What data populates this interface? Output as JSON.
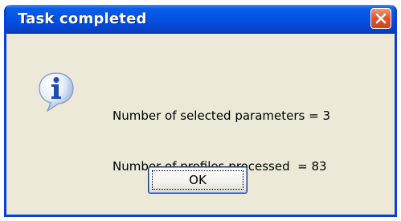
{
  "dialog": {
    "title": "Task completed",
    "close_icon": "close-icon",
    "message_icon": "info-icon",
    "message_lines": [
      "Number of selected parameters = 3",
      "Number of profiles processed  = 83"
    ],
    "ok_label": "OK"
  },
  "colors": {
    "titlebar": "#0555e6",
    "close_button": "#e2552f",
    "dialog_bg": "#ece9d8",
    "border": "#0a3fd6"
  }
}
